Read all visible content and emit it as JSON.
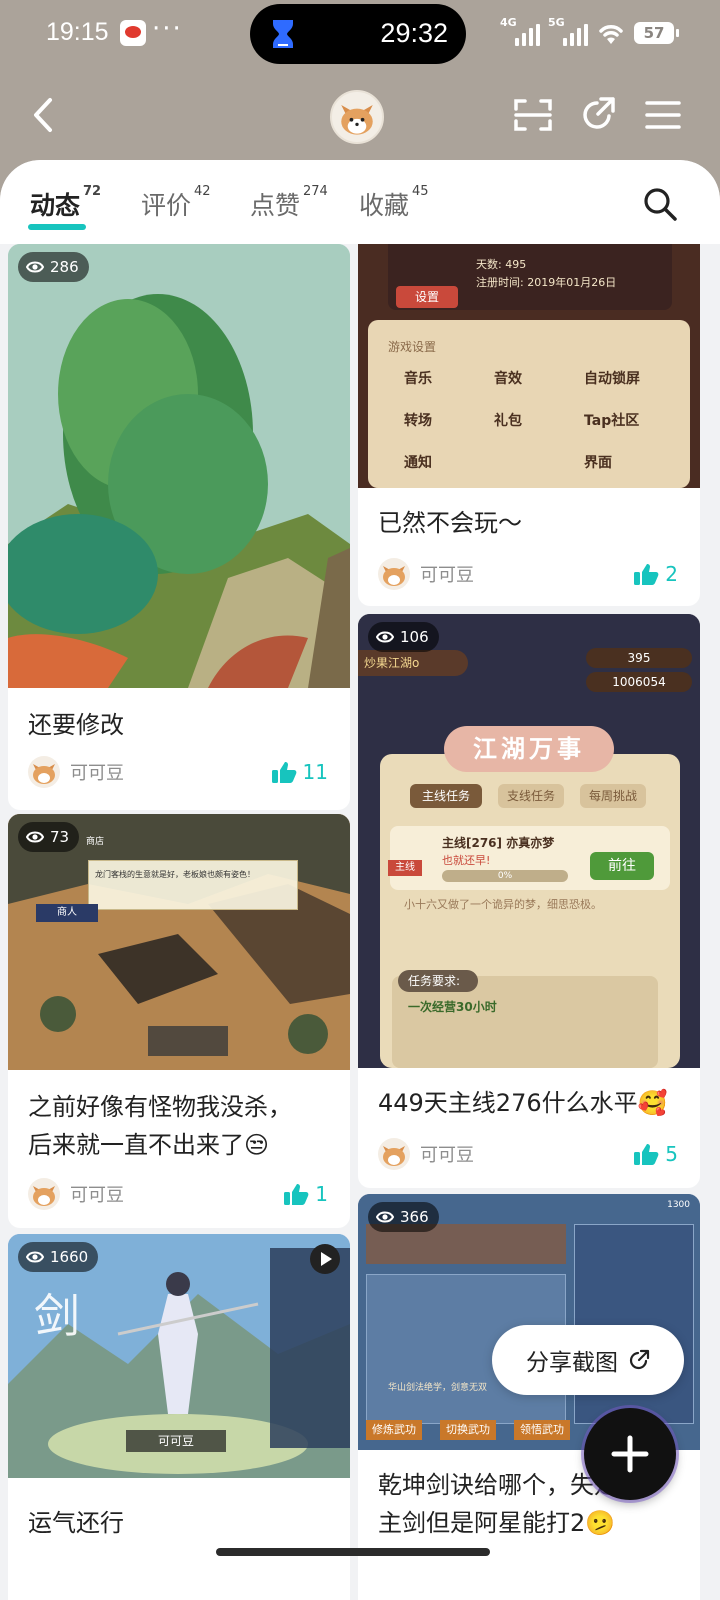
{
  "status_bar": {
    "time": "19:15",
    "more": "···",
    "timer": "29:32",
    "net1": "4G",
    "net2": "5G",
    "battery": "57"
  },
  "tabs": [
    {
      "label": "动态",
      "count": "72"
    },
    {
      "label": "评价",
      "count": "42"
    },
    {
      "label": "点赞",
      "count": "274"
    },
    {
      "label": "收藏",
      "count": "45"
    }
  ],
  "posts": [
    {
      "views": "286",
      "title": "还要修改",
      "author": "可可豆",
      "likes": "11"
    },
    {
      "views": "",
      "title": "已然不会玩～",
      "author": "可可豆",
      "likes": "2",
      "screen": {
        "days": "天数: 495",
        "reg": "注册时间: 2019年01月26日",
        "settings_btn": "设置",
        "section": "游戏设置",
        "options": [
          "音乐",
          "音效",
          "自动锁屏",
          "转场",
          "礼包",
          "Tap社区",
          "通知",
          "",
          "界面"
        ]
      }
    },
    {
      "views": "73",
      "title_line1": "之前好像有怪物我没杀，",
      "title_line2": "后来就一直不出来了😒",
      "author": "可可豆",
      "likes": "1",
      "screen": {
        "dialog": "龙门客栈的生意就是好，老板娘也颇有姿色！",
        "npc": "商人",
        "shop": "商店"
      }
    },
    {
      "views": "106",
      "title": "449天主线276什么水平🥰",
      "author": "可可豆",
      "likes": "5",
      "screen": {
        "player": "炒果江湖o",
        "jade": "395",
        "coins": "1006054",
        "banner": "江湖万事",
        "tab1": "主线任务",
        "tab2": "支线任务",
        "tab3": "每周挑战",
        "quest": "主线[276] 亦真亦梦",
        "quest_sub": "也就还早!",
        "progress": "0%",
        "quest_tag": "主线",
        "go": "前往",
        "desc": "小十六又做了一个诡异的梦，细思恐极。",
        "req_label": "任务要求:",
        "req": "一次经营30小时"
      }
    },
    {
      "views": "1660",
      "title": "运气还行",
      "author": "",
      "likes": "",
      "screen": {
        "glyph": "剑",
        "name": "可可豆"
      }
    },
    {
      "views": "366",
      "title_line1": "乾坤剑诀给哪个，",
      "title_line1b": "失是",
      "title_line2": "主剑但是阿星能打2🫤",
      "author": "",
      "likes": "",
      "screen": {
        "btn1": "修炼武功",
        "btn2": "切换武功",
        "btn3": "领悟武功",
        "sect": "华山剑法绝学，剑意无双",
        "gold": "1300"
      }
    }
  ],
  "share_label": "分享截图",
  "colors": {
    "accent": "#17c4be",
    "header_bg": "#aba39a",
    "sheet_bg": "#f1f2f4"
  },
  "icons": [
    "back-icon",
    "scan-icon",
    "share-icon",
    "menu-icon",
    "search-icon",
    "eye-icon",
    "thumb-up-icon",
    "plus-icon"
  ]
}
